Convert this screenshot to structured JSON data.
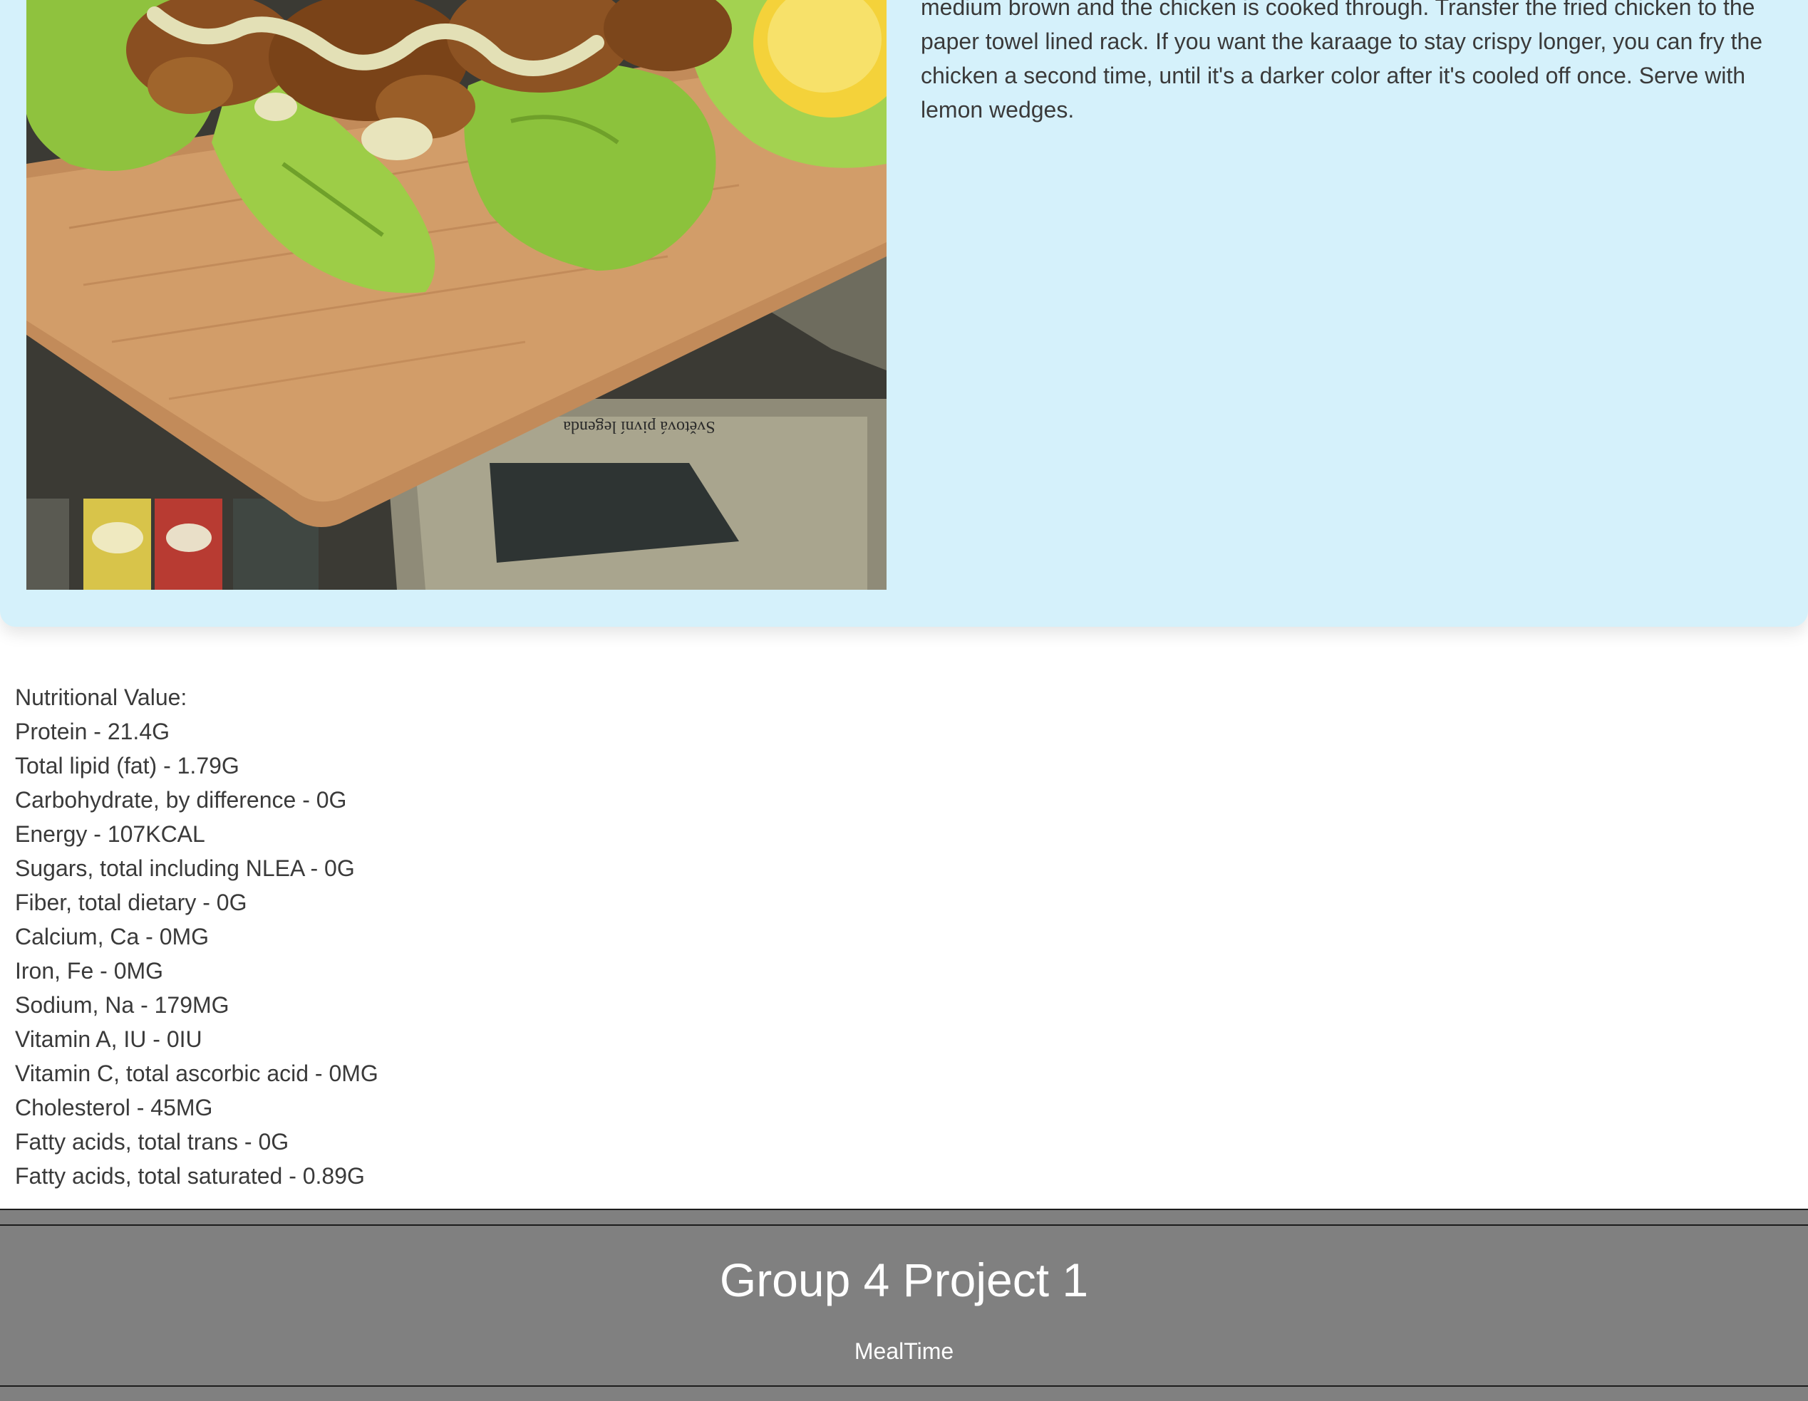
{
  "recipe": {
    "image_alt": "Karaage fried chicken on lettuce with lemon wedge on a wooden board",
    "instructions_text": "medium brown and the chicken is cooked through. Transfer the fried chicken to the paper towel lined rack. If you want the karaage to stay crispy longer, you can fry the chicken a second time, until it's a darker color after it's cooled off once. Serve with lemon wedges."
  },
  "nutrition": {
    "heading": "Nutritional Value:",
    "items": [
      "Protein - 21.4G",
      "Total lipid (fat) - 1.79G",
      "Carbohydrate, by difference - 0G",
      "Energy - 107KCAL",
      "Sugars, total including NLEA - 0G",
      "Fiber, total dietary - 0G",
      "Calcium, Ca - 0MG",
      "Iron, Fe - 0MG",
      "Sodium, Na - 179MG",
      "Vitamin A, IU - 0IU",
      "Vitamin C, total ascorbic acid - 0MG",
      "Cholesterol - 45MG",
      "Fatty acids, total trans - 0G",
      "Fatty acids, total saturated - 0.89G"
    ]
  },
  "footer": {
    "title": "Group 4 Project 1",
    "subtitle": "MealTime"
  },
  "colors": {
    "card_background": "#d5f1fb",
    "footer_background": "#808080",
    "text": "#3a3a3a"
  }
}
